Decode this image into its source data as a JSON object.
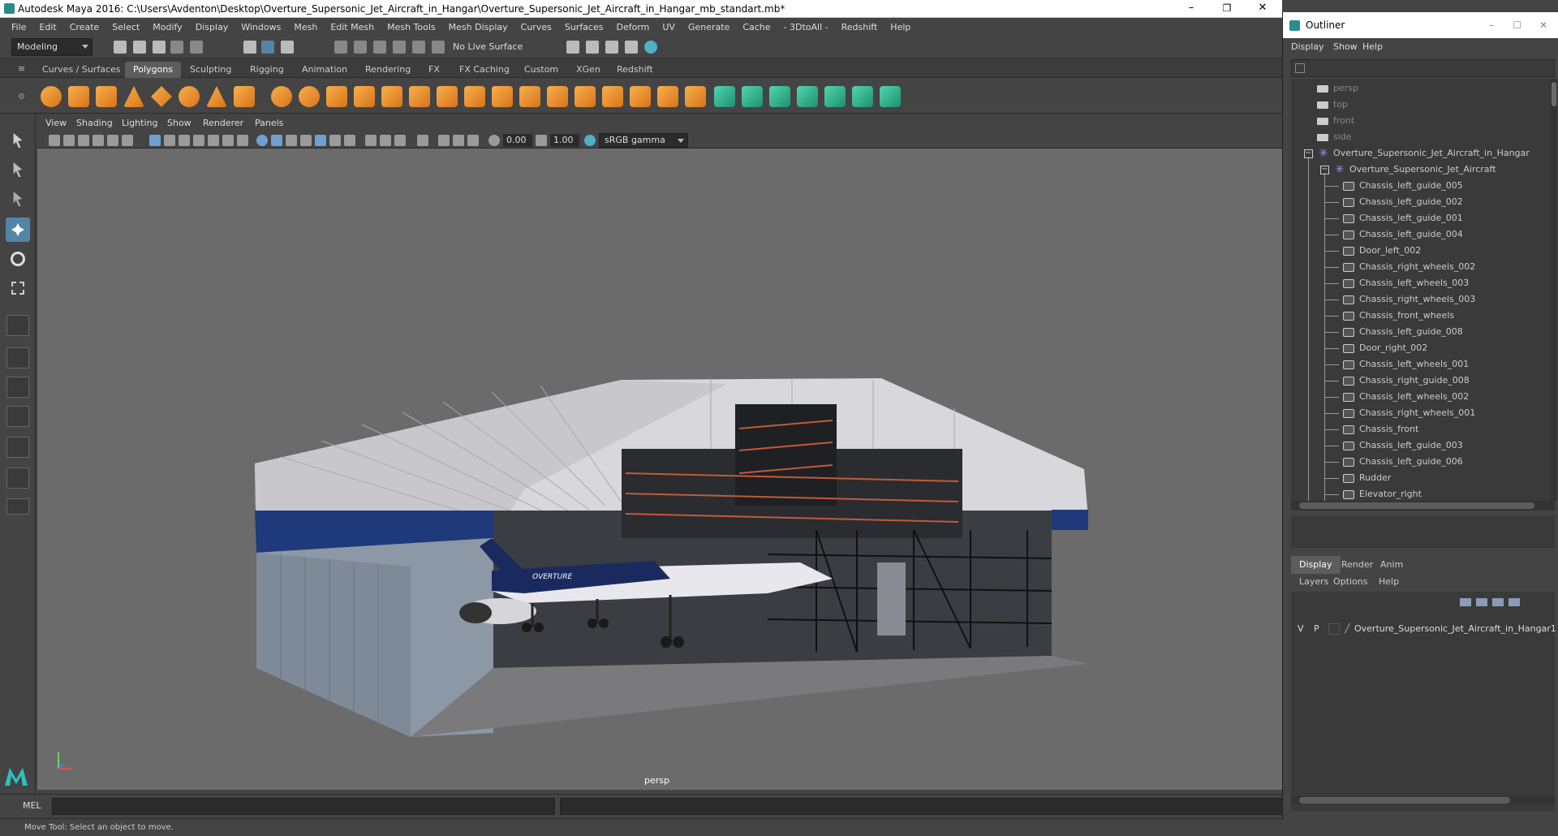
{
  "title": "Autodesk Maya 2016: C:\\Users\\Avdenton\\Desktop\\Overture_Supersonic_Jet_Aircraft_in_Hangar\\Overture_Supersonic_Jet_Aircraft_in_Hangar_mb_standart.mb*",
  "menu": [
    "File",
    "Edit",
    "Create",
    "Select",
    "Modify",
    "Display",
    "Windows",
    "Mesh",
    "Edit Mesh",
    "Mesh Tools",
    "Mesh Display",
    "Curves",
    "Surfaces",
    "Deform",
    "UV",
    "Generate",
    "Cache",
    "- 3DtoAll -",
    "Redshift",
    "Help"
  ],
  "status": {
    "mode": "Modeling",
    "live_surface": "No Live Surface"
  },
  "shelf_tabs": [
    "Curves / Surfaces",
    "Polygons",
    "Sculpting",
    "Rigging",
    "Animation",
    "Rendering",
    "FX",
    "FX Caching",
    "Custom",
    "XGen",
    "Redshift"
  ],
  "active_shelf_tab": "Polygons",
  "viewport_menu": [
    "View",
    "Shading",
    "Lighting",
    "Show",
    "Renderer",
    "Panels"
  ],
  "viewport_toolbar": {
    "exposure": "0.00",
    "gamma": "1.00",
    "color_space": "sRGB gamma"
  },
  "viewport_label": "persp",
  "outliner": {
    "title": "Outliner",
    "menu": [
      "Display",
      "Show",
      "Help"
    ],
    "cameras": [
      "persp",
      "top",
      "front",
      "side"
    ],
    "root": "Overture_Supersonic_Jet_Aircraft_in_Hangar",
    "group": "Overture_Supersonic_Jet_Aircraft",
    "items": [
      "Chassis_left_guide_005",
      "Chassis_left_guide_002",
      "Chassis_left_guide_001",
      "Chassis_left_guide_004",
      "Door_left_002",
      "Chassis_right_wheels_002",
      "Chassis_left_wheels_003",
      "Chassis_right_wheels_003",
      "Chassis_front_wheels",
      "Chassis_left_guide_008",
      "Door_right_002",
      "Chassis_left_wheels_001",
      "Chassis_right_guide_008",
      "Chassis_left_wheels_002",
      "Chassis_right_wheels_001",
      "Chassis_front",
      "Chassis_left_guide_003",
      "Chassis_left_guide_006",
      "Rudder",
      "Elevator_right"
    ]
  },
  "layers": {
    "tabs": [
      "Display",
      "Render",
      "Anim"
    ],
    "active_tab": "Display",
    "menu": [
      "Layers",
      "Options",
      "Help"
    ],
    "row": {
      "v": "V",
      "p": "P",
      "name": "Overture_Supersonic_Jet_Aircraft_in_Hangar1"
    }
  },
  "cmd": {
    "label": "MEL"
  },
  "help_line": "Move Tool: Select an object to move."
}
